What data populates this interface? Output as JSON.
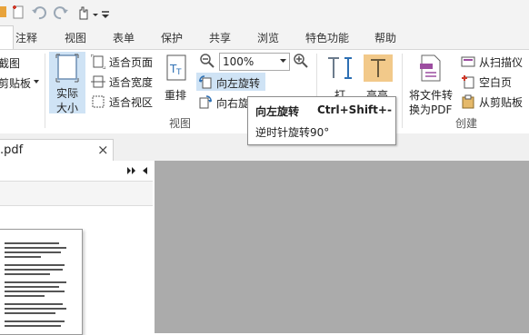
{
  "ribbon_tabs": [
    "注释",
    "视图",
    "表单",
    "保护",
    "共享",
    "浏览",
    "特色功能",
    "帮助"
  ],
  "view_group": {
    "snapshot_label": "截图",
    "clipboard_label": "剪贴板",
    "actual_size_label_line1": "实际",
    "actual_size_label_line2": "大小",
    "fit_page_label": "适合页面",
    "fit_width_label": "适合宽度",
    "fit_visible_label": "适合视区",
    "reflow_label": "重排",
    "zoom_value": "100%",
    "rotate_left_label": "向左旋转",
    "rotate_right_label": "向右旋转",
    "group_label": "视图"
  },
  "typewriter_group": {
    "typewriter_label": "打",
    "highlight_label": "高亮"
  },
  "create_group": {
    "to_pdf_line1": "将文件转",
    "to_pdf_line2": "换为PDF",
    "from_scanner_label": "从扫描仪",
    "blank_page_label": "空白页",
    "from_clipboard_label": "从剪贴板",
    "group_label": "创建"
  },
  "tooltip": {
    "title": "向左旋转",
    "shortcut": "Ctrl+Shift+-",
    "description": "逆时针旋转90°"
  },
  "document_tab": {
    "filename": ".pdf",
    "close_glyph": "×"
  },
  "colors": {
    "highlight_active": "#cfe3f5",
    "highlight_icon_bg": "#f2c98a",
    "document_background": "#ababab"
  }
}
